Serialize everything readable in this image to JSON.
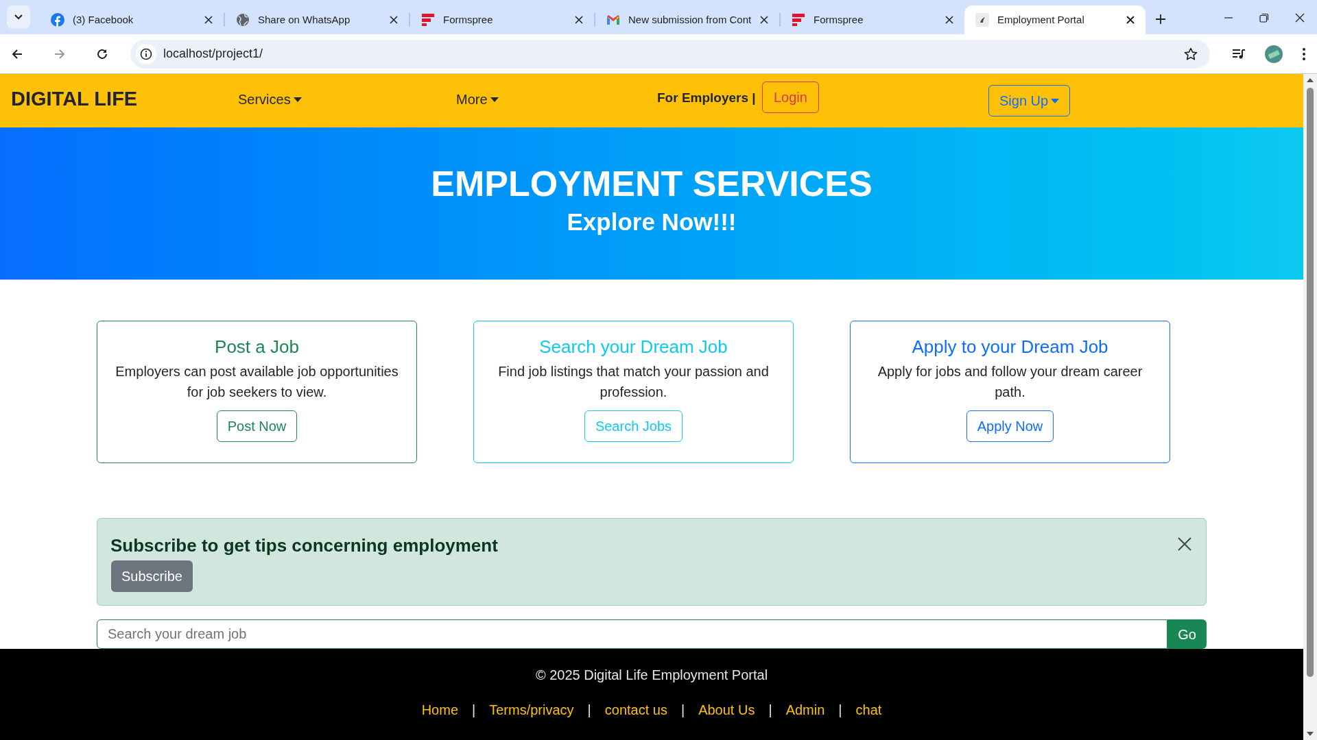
{
  "browser": {
    "tabs": [
      {
        "title": "(3) Facebook",
        "kind": "facebook",
        "selected": false
      },
      {
        "title": "Share on WhatsApp",
        "kind": "globe",
        "selected": false
      },
      {
        "title": "Formspree",
        "kind": "formspree",
        "selected": false
      },
      {
        "title": "New submission from Cont",
        "kind": "gmail",
        "selected": false
      },
      {
        "title": "Formspree",
        "kind": "formspree",
        "selected": false
      },
      {
        "title": "Employment Portal",
        "kind": "site",
        "selected": true
      }
    ],
    "address": "localhost/project1/"
  },
  "navbar": {
    "brand": "DIGITAL LIFE",
    "menus": [
      "Services",
      "More"
    ],
    "employers_label": "For Employers |",
    "login": "Login",
    "signup": "Sign Up"
  },
  "hero": {
    "title": "EMPLOYMENT SERVICES",
    "subtitle": "Explore Now!!!"
  },
  "cards": [
    {
      "title": "Post a Job",
      "text": "Employers can post available job opportunities for job seekers to view.",
      "button": "Post Now",
      "color": "#198754"
    },
    {
      "title": "Search your Dream Job",
      "text": "Find job listings that match your passion and profession.",
      "button": "Search Jobs",
      "color": "#0dcaf0"
    },
    {
      "title": "Apply to your Dream Job",
      "text": "Apply for jobs and follow your dream career path.",
      "button": "Apply Now",
      "color": "#0d6efd"
    }
  ],
  "alert": {
    "title": "Subscribe to get tips concerning employment",
    "button": "Subscribe"
  },
  "search": {
    "placeholder": "Search your dream job",
    "button": "Go"
  },
  "footer": {
    "copyright": "© 2025 Digital Life Employment Portal",
    "items": [
      {
        "kind": "link",
        "text": "Home"
      },
      {
        "kind": "separator",
        "text": "|"
      },
      {
        "kind": "link",
        "text": "Terms/privacy"
      },
      {
        "kind": "separator",
        "text": "|"
      },
      {
        "kind": "link",
        "text": "contact us"
      },
      {
        "kind": "separator",
        "text": "|"
      },
      {
        "kind": "link",
        "text": "About Us"
      },
      {
        "kind": "separator",
        "text": "|"
      },
      {
        "kind": "link",
        "text": "Admin"
      },
      {
        "kind": "separator",
        "text": "|"
      },
      {
        "kind": "link",
        "text": "chat"
      }
    ]
  }
}
